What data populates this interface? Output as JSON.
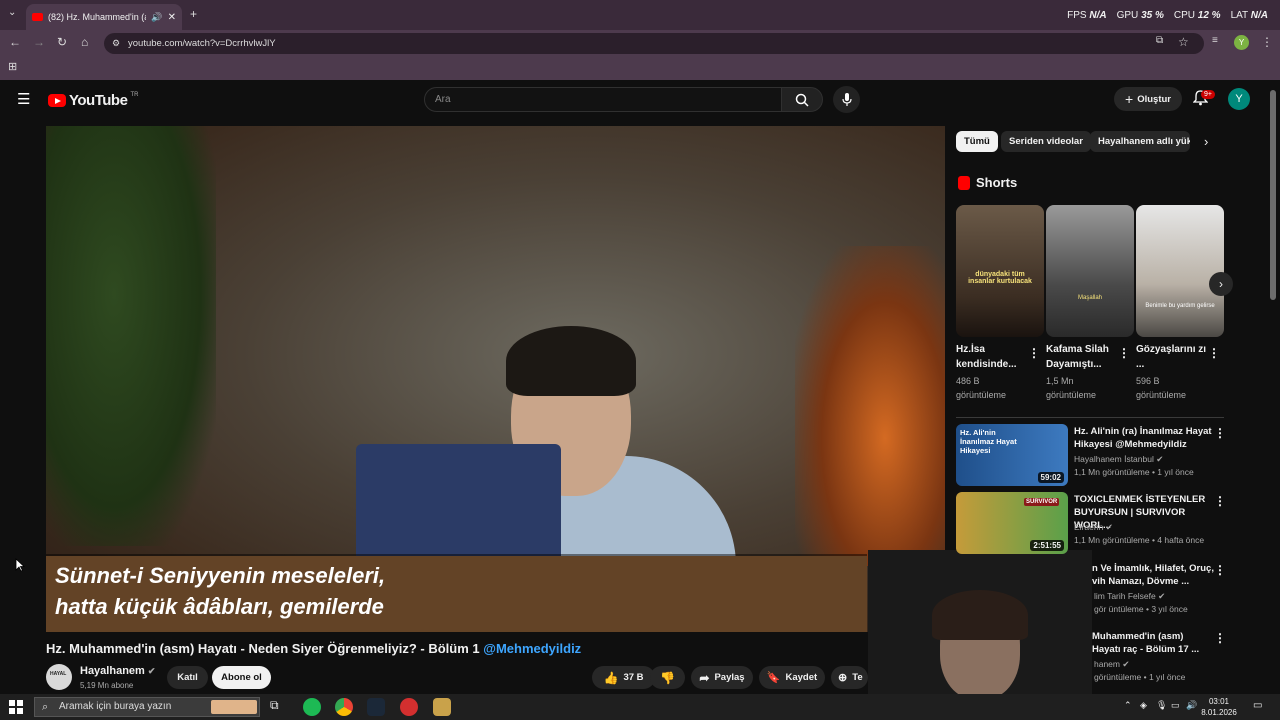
{
  "browser": {
    "tab_title": "(82) Hz. Muhammed'in (asm",
    "url": "youtube.com/watch?v=DcrrhvlwJlY",
    "profile_initial": "Y",
    "stats": [
      {
        "label": "FPS",
        "value": "N/A"
      },
      {
        "label": "GPU",
        "value": "35 %"
      },
      {
        "label": "CPU",
        "value": "12 %"
      },
      {
        "label": "LAT",
        "value": "N/A"
      }
    ]
  },
  "header": {
    "logo_text": "YouTube",
    "logo_country": "TR",
    "search_placeholder": "Ara",
    "create_label": "Oluştur",
    "notification_count": "9+",
    "avatar_initial": "Y"
  },
  "video": {
    "caption_line1": "Sünnet-i Seniyyenin meseleleri,",
    "caption_line2": "hatta küçük âdâbları, gemilerde",
    "title": "Hz. Muhammed'in (asm) Hayatı - Neden Siyer Öğrenmeliyiz? - Bölüm 1",
    "title_tag": "@Mehmedyildiz",
    "channel_name": "Hayalhanem",
    "channel_subs": "5,19 Mn abone",
    "join_label": "Katıl",
    "subscribe_label": "Abone ol",
    "like_count": "37 B",
    "share_label": "Paylaş",
    "save_label": "Kaydet",
    "more_label": "Te"
  },
  "sidebar": {
    "chips": [
      "Tümü",
      "Seriden videolar",
      "Hayalhanem adlı yük"
    ],
    "shorts_heading": "Shorts",
    "shorts": [
      {
        "title": "Hz.İsa kendisinde...",
        "views": "486 B",
        "views_unit": "görüntüleme",
        "overlay": "dünyadaki tüm insanlar kurtulacak"
      },
      {
        "title": "Kafama Silah Dayamıştı...",
        "views": "1,5 Mn",
        "views_unit": "görüntüleme",
        "overlay": "Maşallah"
      },
      {
        "title": "Gözyaşlarını zı ...",
        "views": "596 B",
        "views_unit": "görüntüleme",
        "overlay": "Benimle bu yardım gelirse"
      }
    ],
    "recommendations": [
      {
        "title": "Hz. Ali'nin (ra) İnanılmaz Hayat Hikayesi @Mehmedyildiz",
        "channel": "Hayalhanem İstanbul",
        "meta": "1,1 Mn görüntüleme • 1 yıl önce",
        "duration": "59:02",
        "thumb_text": "Hz. Ali'nin İnanılmaz Hayat Hikayesi"
      },
      {
        "title": "TOXICLENMEK İSTEYENLER BUYURSUN | SURVIVOR WORL...",
        "channel": "Elraenn",
        "meta": "1,1 Mn görüntüleme • 4 hafta önce",
        "duration": "2:51:55",
        "thumb_text": "SURVIVOR"
      },
      {
        "title": "n Ve İmamlık, Hilafet, Oruç, vih Namazı, Dövme ...",
        "channel": "lim Tarih Felsefe",
        "meta": "gör üntüleme • 3 yıl önce",
        "duration": "",
        "thumb_text": ""
      },
      {
        "title": "Muhammed'in (asm) Hayatı raç - Bölüm 17 ...",
        "channel": "hanem",
        "meta": "görüntüleme • 1 yıl önce",
        "duration": "",
        "thumb_text": ""
      }
    ]
  },
  "taskbar": {
    "search_placeholder": "Aramak için buraya yazın",
    "time": "03:01",
    "date": "8.01.2026"
  }
}
